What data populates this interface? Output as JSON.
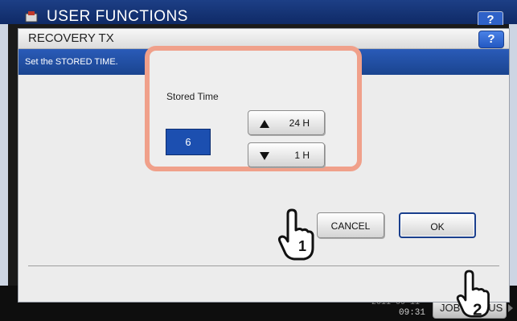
{
  "background": {
    "title": "USER FUNCTIONS",
    "help_label": "?",
    "date": "2011-09-11",
    "time": "09:31",
    "job_status_label": "JOB STATUS"
  },
  "dialog": {
    "title": "RECOVERY TX",
    "help_label": "?",
    "message": "Set the STORED TIME.",
    "stored_time_label": "Stored Time",
    "stored_time_value": "6",
    "up_button_label": "24 H",
    "down_button_label": "1 H",
    "cancel_label": "CANCEL",
    "ok_label": "OK"
  },
  "annotations": {
    "step1": "1",
    "step2": "2",
    "highlight_color": "#f0a08a"
  },
  "colors": {
    "accent_blue": "#1c4fb0",
    "header_blue": "#1d3f86"
  }
}
